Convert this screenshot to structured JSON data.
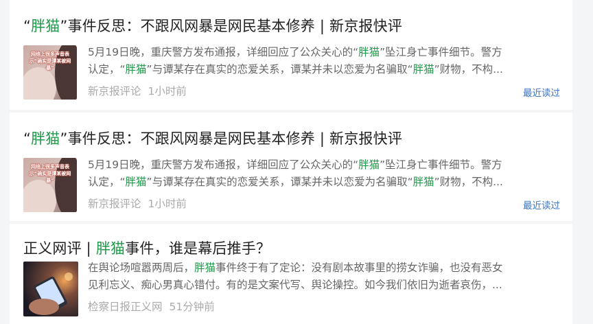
{
  "results": [
    {
      "title_pre": "“",
      "title_hl": "胖猫",
      "title_post": "”事件反思：不跟风网暴是网民基本修养 | 新京报快评",
      "line1_pre": "5月19日晚，重庆警方发布通报，详细回应了公众关心的“",
      "line1_hl": "胖猫",
      "line1_post": "”坠江身亡事件细节。警方",
      "line2_a": "认定，“",
      "line2_hl1": "胖猫",
      "line2_b": "”与谭某存在真实的恋爱关系，谭某并未以恋爱为名骗取“",
      "line2_hl2": "胖猫",
      "line2_c": "”财物，不构...",
      "source": "新京报评论",
      "time": "1小时前",
      "recent_label": "最近读过",
      "thumb_caption": "网络上很多声音表示“确实是谭某被网暴”",
      "thumb_icon": "person-photo-thumbnail"
    },
    {
      "title_pre": "“",
      "title_hl": "胖猫",
      "title_post": "”事件反思：不跟风网暴是网民基本修养 | 新京报快评",
      "line1_pre": "5月19日晚，重庆警方发布通报，详细回应了公众关心的“",
      "line1_hl": "胖猫",
      "line1_post": "”坠江身亡事件细节。警方",
      "line2_a": "认定，“",
      "line2_hl1": "胖猫",
      "line2_b": "”与谭某存在真实的恋爱关系，谭某并未以恋爱为名骗取“",
      "line2_hl2": "胖猫",
      "line2_c": "”财物，不构...",
      "source": "新京报评论",
      "time": "1小时前",
      "recent_label": "最近读过",
      "thumb_caption": "网络上很多声音表示“确实是谭某被网暴”",
      "thumb_icon": "person-photo-thumbnail"
    },
    {
      "title_pre": "正义网评 | ",
      "title_hl": "胖猫",
      "title_post": "事件，谁是幕后推手？",
      "line1_pre": "在舆论场喧嚣两周后，",
      "line1_hl": "胖猫",
      "line1_post": "事件终于有了定论：没有剧本故事里的捞女诈骗，也没有恶女",
      "line2_text": "见利忘义、痴心男真心错付。有的是文案代写、舆论操控。如今我们依旧为逝者哀伤，...",
      "source": "检察日报正义网",
      "time": "51分钟前",
      "thumb_icon": "phone-in-hand-thumbnail"
    }
  ],
  "colors": {
    "highlight": "#1d9a48",
    "link": "#3b74c4",
    "meta": "#aaaaaa",
    "summary": "#666666"
  }
}
